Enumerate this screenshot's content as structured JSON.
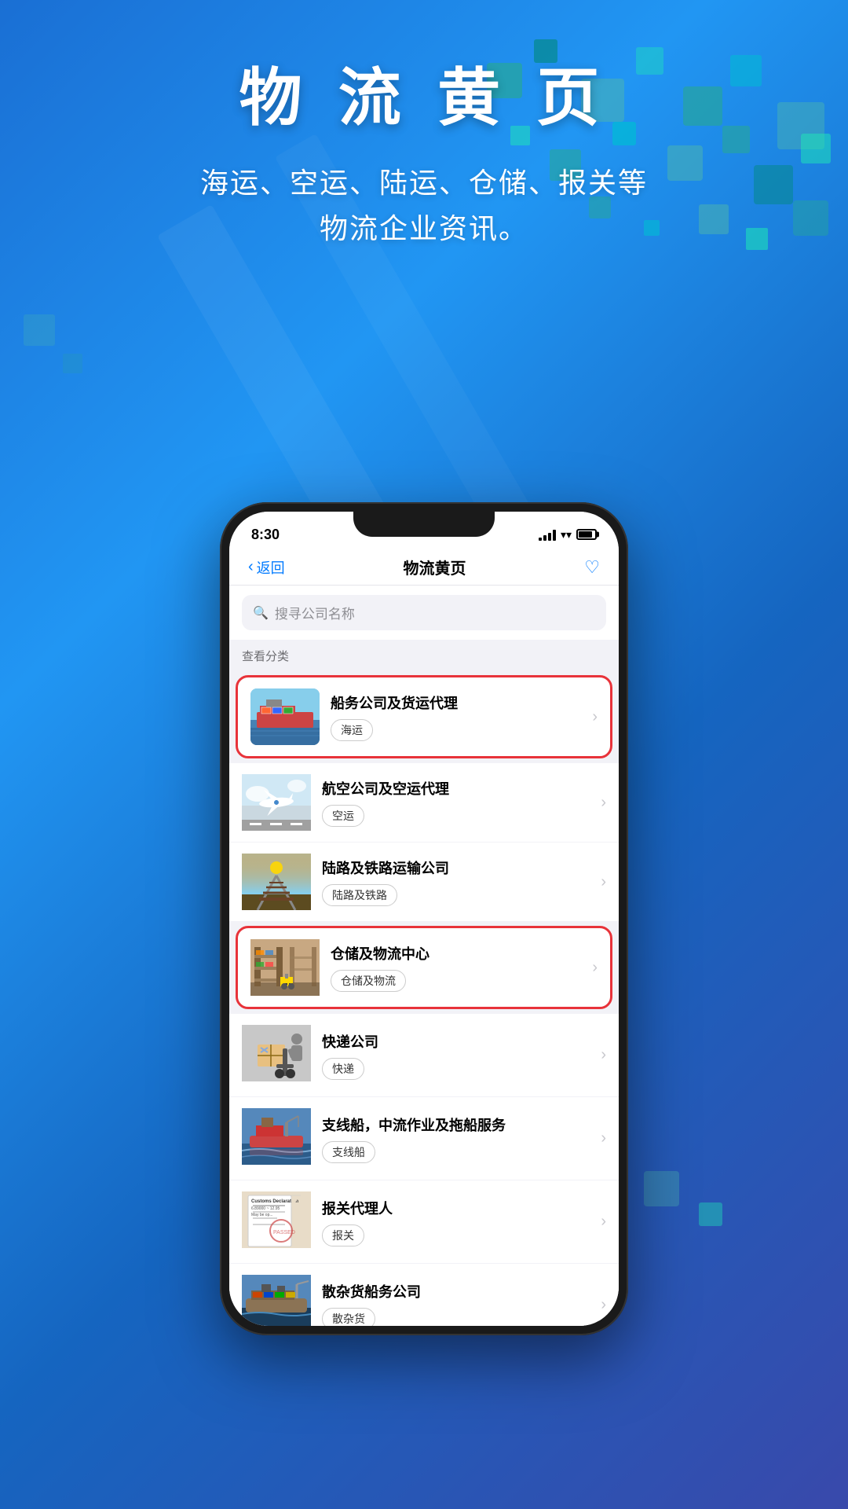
{
  "page": {
    "background_gradient": "linear-gradient(135deg, #1a6fd4, #2196F3, #1565C0, #3949AB)"
  },
  "header": {
    "main_title": "物 流 黄 页",
    "sub_title_line1": "海运、空运、陆运、仓储、报关等",
    "sub_title_line2": "物流企业资讯。"
  },
  "phone": {
    "status_bar": {
      "time": "8:30"
    },
    "nav": {
      "back_label": "返回",
      "title": "物流黄页",
      "heart_icon": "♡"
    },
    "search": {
      "placeholder": "搜寻公司名称"
    },
    "category_section_label": "查看分类",
    "list_items": [
      {
        "id": "shipping",
        "title": "船务公司及货运代理",
        "tag": "海运",
        "image_type": "ship",
        "highlighted": true
      },
      {
        "id": "airline",
        "title": "航空公司及空运代理",
        "tag": "空运",
        "image_type": "plane",
        "highlighted": false
      },
      {
        "id": "rail",
        "title": "陆路及铁路运输公司",
        "tag": "陆路及铁路",
        "image_type": "rail",
        "highlighted": false
      },
      {
        "id": "warehouse",
        "title": "仓储及物流中心",
        "tag": "仓储及物流",
        "image_type": "warehouse",
        "highlighted": true
      },
      {
        "id": "courier",
        "title": "快递公司",
        "tag": "快递",
        "image_type": "delivery",
        "highlighted": false
      },
      {
        "id": "tugboat",
        "title": "支线船，中流作业及拖船服务",
        "tag": "支线船",
        "image_type": "tugboat",
        "highlighted": false
      },
      {
        "id": "customs",
        "title": "报关代理人",
        "tag": "报关",
        "image_type": "customs",
        "highlighted": false,
        "customs_text": "6.89000~12.95\nCustoms Declaration\nMay be op"
      },
      {
        "id": "bulk",
        "title": "散杂货船务公司",
        "tag": "散杂货",
        "image_type": "bulk",
        "highlighted": false
      }
    ]
  }
}
